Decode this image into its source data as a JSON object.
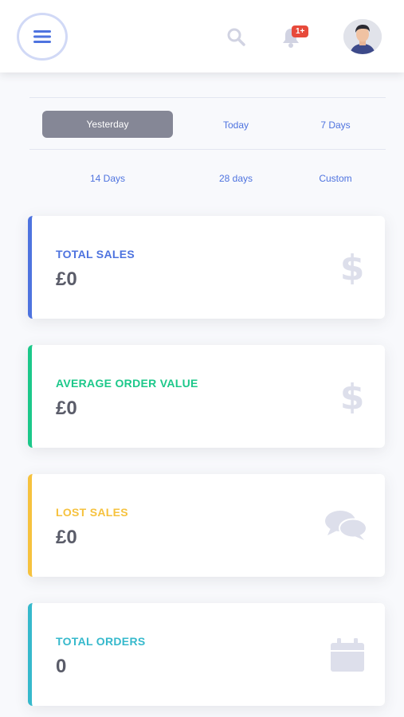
{
  "header": {
    "menu_icon": "hamburger-icon",
    "search_icon": "search-icon",
    "notifications": {
      "icon": "bell-icon",
      "badge": "1+"
    },
    "avatar_icon": "user-avatar"
  },
  "date_ranges": [
    {
      "label": "Yesterday",
      "active": true
    },
    {
      "label": "Today",
      "active": false
    },
    {
      "label": "7 Days",
      "active": false
    },
    {
      "label": "14 Days",
      "active": false
    },
    {
      "label": "28 days",
      "active": false
    },
    {
      "label": "Custom",
      "active": false
    }
  ],
  "cards": [
    {
      "label": "TOTAL SALES",
      "value": "£0",
      "accent": "#4e73df",
      "icon": "dollar-icon"
    },
    {
      "label": "AVERAGE ORDER VALUE",
      "value": "£0",
      "accent": "#1cc88a",
      "icon": "dollar-icon"
    },
    {
      "label": "LOST SALES",
      "value": "£0",
      "accent": "#f6c23e",
      "icon": "comments-icon"
    },
    {
      "label": "TOTAL ORDERS",
      "value": "0",
      "accent": "#36b9cc",
      "icon": "calendar-icon"
    }
  ],
  "colors": {
    "icon_gray": "#dddfeb",
    "link_blue": "#4e73df",
    "active_bg": "#858796"
  }
}
